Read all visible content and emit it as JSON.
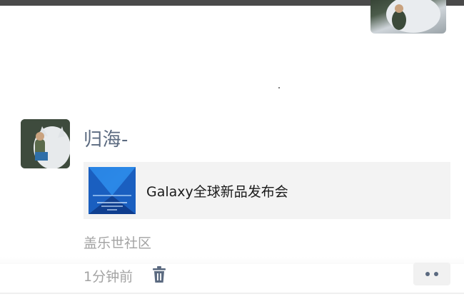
{
  "feed_item": {
    "username": "归海-",
    "shared_card": {
      "title": "Galaxy全球新品发布会",
      "thumbnail_icon": "galaxy-event-thumbnail"
    },
    "source": "盖乐世社区",
    "timestamp": "1分钟前",
    "delete_icon": "trash-icon",
    "more_icon": "more-dots-icon"
  },
  "colors": {
    "username": "#5b6a80",
    "meta_text": "#a3a3a3",
    "card_bg": "#f3f3f3",
    "icon_accent": "#5b6a80"
  }
}
